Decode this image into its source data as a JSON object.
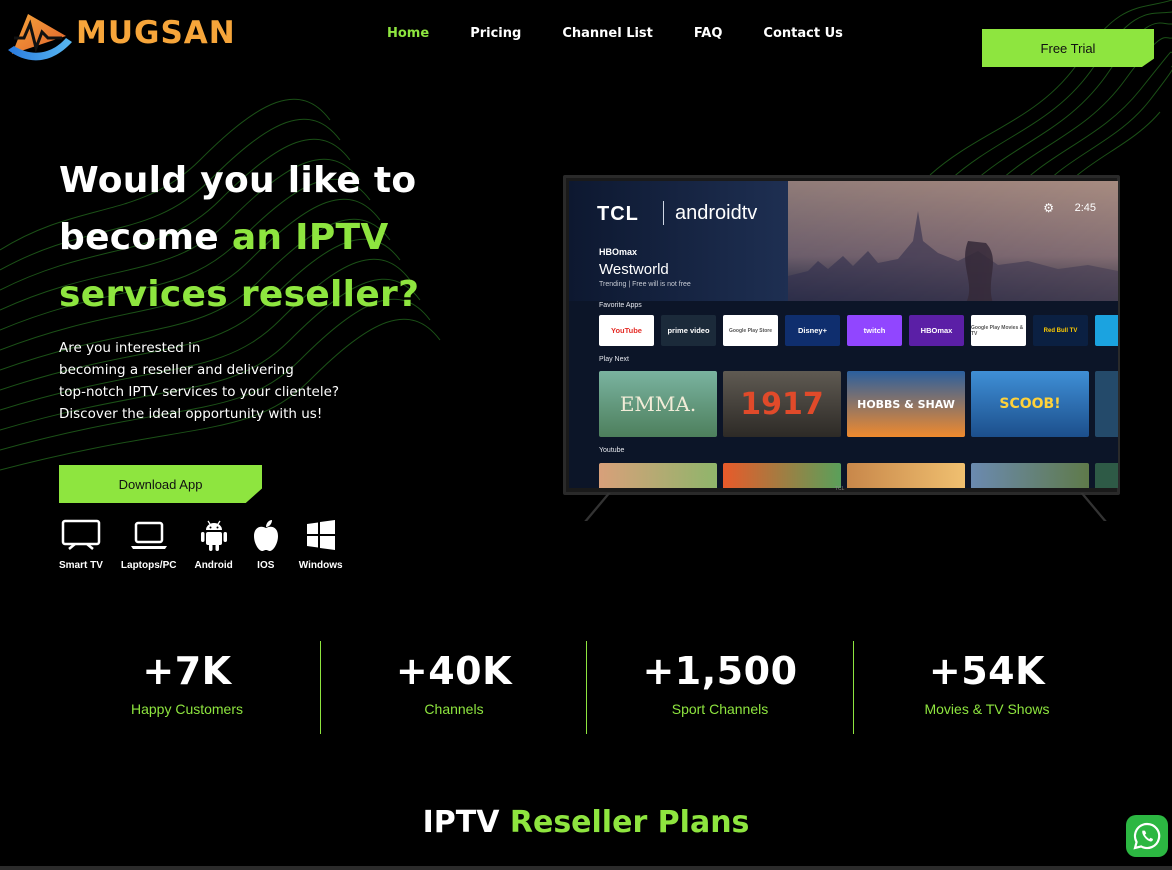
{
  "brand": {
    "name": "MUGSAN"
  },
  "nav": {
    "items": [
      {
        "label": "Home",
        "active": true
      },
      {
        "label": "Pricing",
        "active": false
      },
      {
        "label": "Channel List",
        "active": false
      },
      {
        "label": "FAQ",
        "active": false
      },
      {
        "label": "Contact Us",
        "active": false
      }
    ]
  },
  "header": {
    "cta_label": "Free Trial"
  },
  "hero": {
    "title_line1": "Would you like to",
    "title_line2_white": "become ",
    "title_line2_green": "an IPTV",
    "title_line3_green": "services reseller?",
    "desc_lines": [
      "Are you interested in",
      "becoming a reseller and delivering",
      "top-notch IPTV services to your clientele?",
      "Discover the ideal opportunity with us!"
    ],
    "download_label": "Download App"
  },
  "platforms": [
    {
      "label": "Smart TV",
      "icon": "smart-tv-icon"
    },
    {
      "label": "Laptops/PC",
      "icon": "laptop-icon"
    },
    {
      "label": "Android",
      "icon": "android-icon"
    },
    {
      "label": "IOS",
      "icon": "apple-icon"
    },
    {
      "label": "Windows",
      "icon": "windows-icon"
    }
  ],
  "tv": {
    "brand": "TCL",
    "os": "androidtv",
    "time": "2:45",
    "featured_service": "HBOmax",
    "featured_title": "Westworld",
    "featured_sub": "Trending | Free will is not free",
    "section_apps": "Favorite Apps",
    "section_play": "Play Next",
    "section_youtube": "Youtube",
    "apps": [
      "YouTube",
      "prime video",
      "Google Play Store",
      "Disney+",
      "twitch",
      "HBOmax",
      "Google Play Movies & TV",
      "Red Bull TV"
    ],
    "play_next": [
      "EMMA.",
      "1917",
      "HOBBS & SHAW",
      "SCOOB!"
    ]
  },
  "stats": [
    {
      "value": "+7K",
      "label": "Happy Customers"
    },
    {
      "value": "+40K",
      "label": "Channels"
    },
    {
      "value": "+1,500",
      "label": "Sport Channels"
    },
    {
      "value": "+54K",
      "label": "Movies & TV Shows"
    }
  ],
  "plans": {
    "title_white": "IPTV ",
    "title_green": "Reseller Plans"
  },
  "colors": {
    "accent": "#8ee53f",
    "background": "#000000",
    "logo": "#f6a53a",
    "whatsapp": "#2cb742"
  }
}
